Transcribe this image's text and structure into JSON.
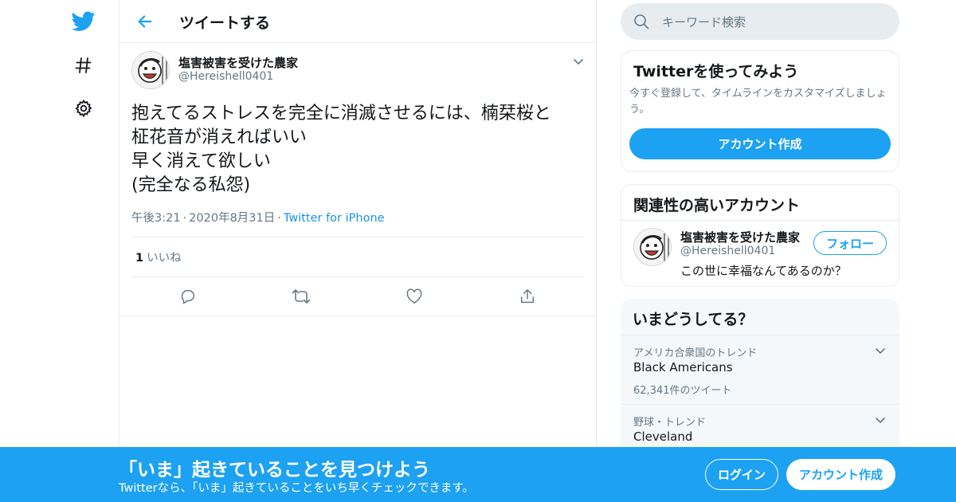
{
  "nav": {
    "icons": [
      "twitter-bird-icon",
      "hashtag-icon",
      "gear-icon"
    ]
  },
  "header": {
    "title": "ツイートする"
  },
  "tweet": {
    "display_name": "塩害被害を受けた農家",
    "handle": "@Hereishell0401",
    "text": "抱えてるストレスを完全に消滅させるには、楠栞桜と\n柾花音が消えればいい\n早く消えて欲しい\n(完全なる私怨)",
    "time": "午後3:21",
    "date": "2020年8月31日",
    "meta_separator": "·",
    "source": "Twitter for iPhone",
    "like_count": "1",
    "like_label": "いいね"
  },
  "search": {
    "placeholder": "キーワード検索"
  },
  "signup_card": {
    "title": "Twitterを使ってみよう",
    "subtitle": "今すぐ登録して、タイムラインをカスタマイズしましょう。",
    "button": "アカウント作成"
  },
  "related": {
    "title": "関連性の高いアカウント",
    "display_name": "塩害被害を受けた農家",
    "handle": "@Hereishell0401",
    "follow_button": "フォロー",
    "bio": "この世に幸福なんてあるのか？"
  },
  "trends": {
    "title": "いまどうしてる？",
    "items": [
      {
        "context": "アメリカ合衆国のトレンド",
        "name": "Black Americans",
        "count": "62,341件のツイート"
      },
      {
        "context": "野球・トレンド",
        "name": "Cleveland"
      }
    ]
  },
  "banner": {
    "title": "「いま」起きていることを見つけよう",
    "subtitle": "Twitterなら、「いま」起きていることをいち早くチェックできます。",
    "login_button": "ログイン",
    "signup_button": "アカウント作成"
  },
  "colors": {
    "accent": "#1da1f2",
    "link": "#1b95e0",
    "secondary_text": "#657786",
    "border": "#e6ecf0"
  }
}
